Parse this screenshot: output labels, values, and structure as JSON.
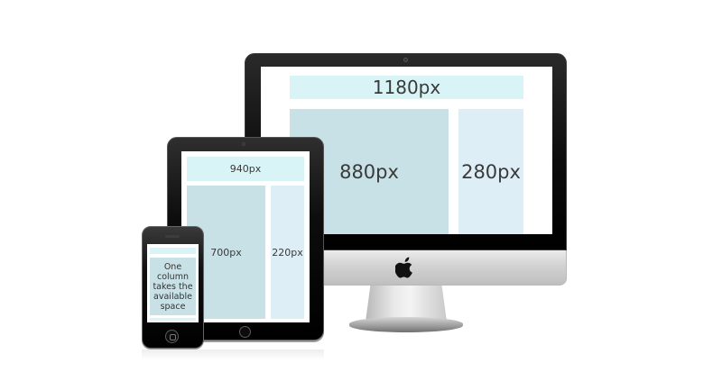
{
  "desktop": {
    "header_label": "1180px",
    "main_label": "880px",
    "sidebar_label": "280px"
  },
  "tablet": {
    "header_label": "940px",
    "main_label": "700px",
    "sidebar_label": "220px"
  },
  "phone": {
    "content_label": "One column takes the available space"
  },
  "colors": {
    "header": "#d9f4f7",
    "main_column": "#c8e1e6",
    "sidebar_column": "#ddeef6",
    "device_black": "#000000",
    "imac_silver": "#d2d2d2"
  },
  "icons": {
    "brand_logo": "apple-logo-icon"
  }
}
